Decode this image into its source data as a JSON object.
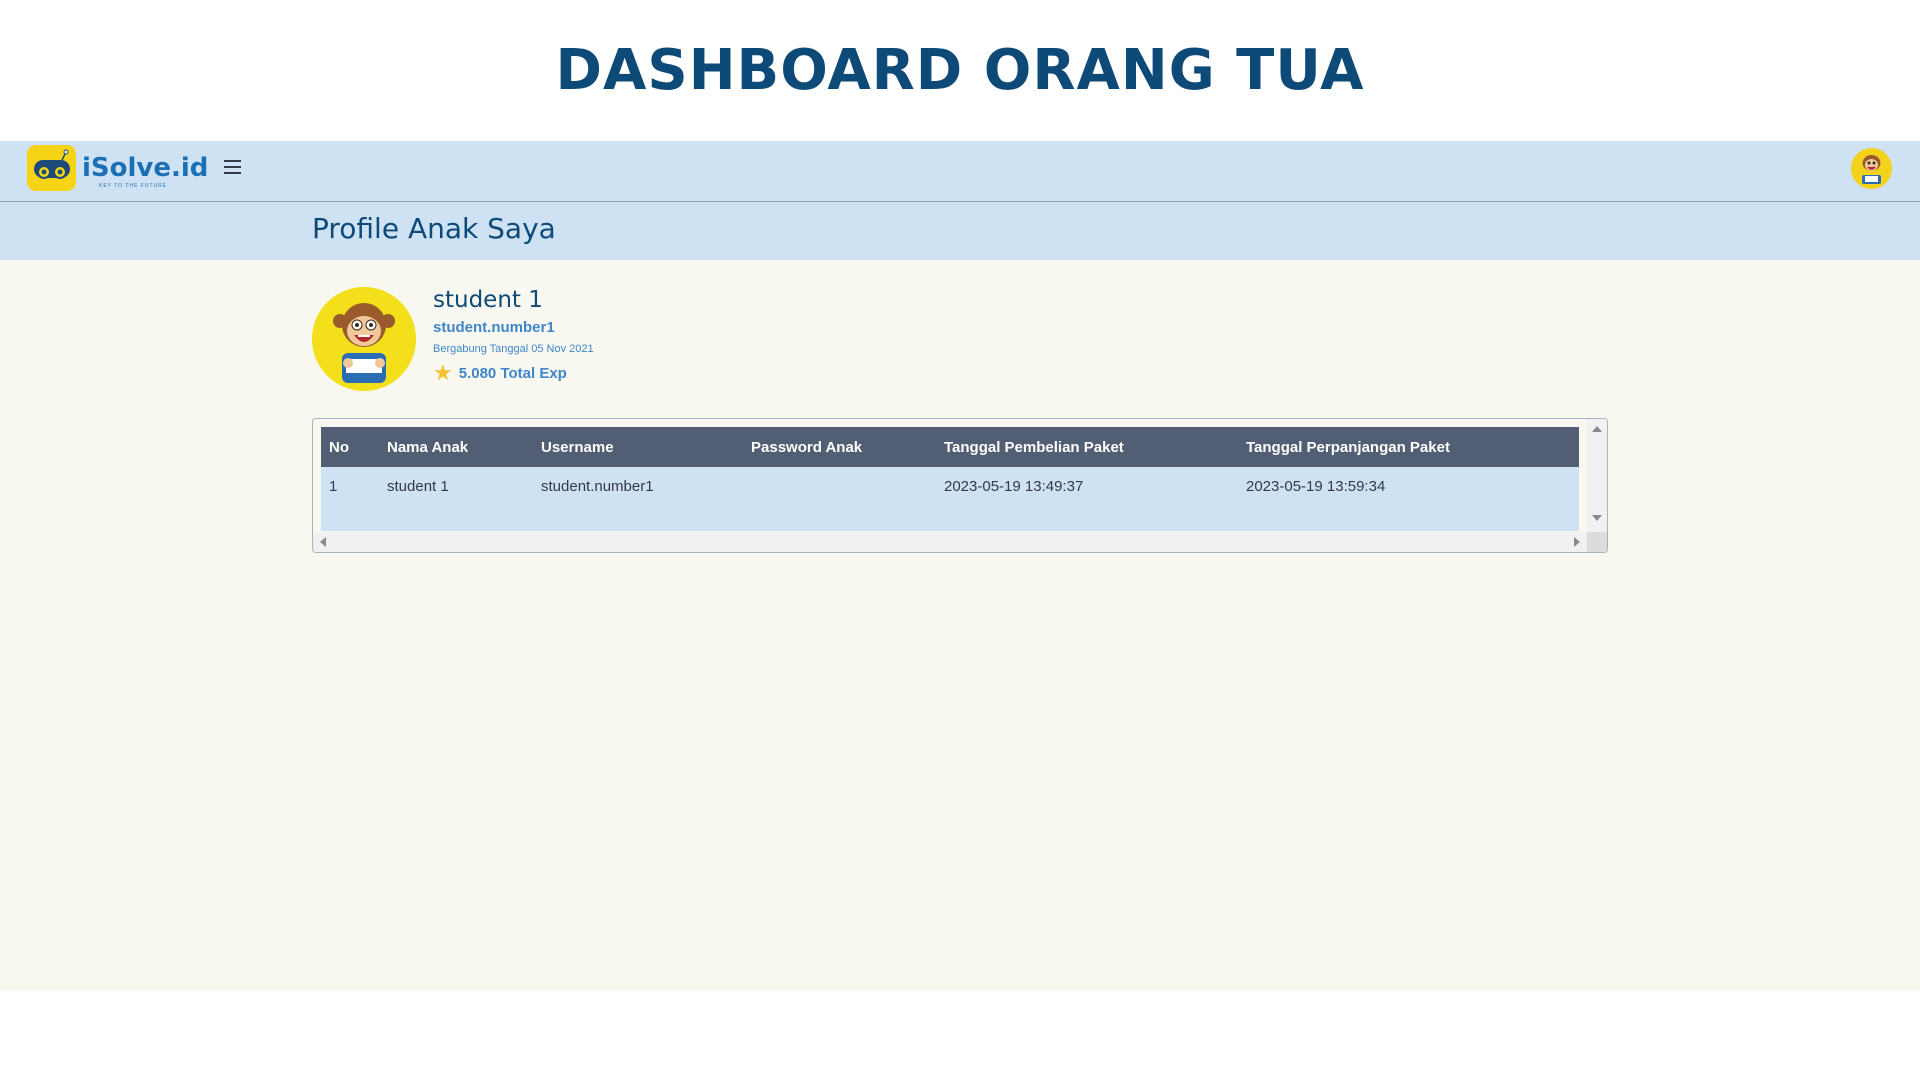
{
  "slide": {
    "title": "DASHBOARD ORANG TUA"
  },
  "navbar": {
    "logo_text": "iSolve.id",
    "logo_tagline": "KEY TO THE FUTURE",
    "menu_icon": "hamburger-icon",
    "user_avatar_icon": "monkey-avatar-icon"
  },
  "page": {
    "title": "Profile Anak Saya"
  },
  "profile": {
    "name": "student 1",
    "username": "student.number1",
    "joined": "Bergabung Tanggal 05 Nov 2021",
    "exp_icon": "star-icon",
    "exp": "5.080 Total Exp"
  },
  "table": {
    "columns": [
      "No",
      "Nama Anak",
      "Username",
      "Password Anak",
      "Tanggal Pembelian Paket",
      "Tanggal Perpanjangan Paket"
    ],
    "rows": [
      [
        "1",
        "student 1",
        "student.number1",
        "",
        "2023-05-19 13:49:37",
        "2023-05-19 13:59:34"
      ]
    ]
  },
  "colors": {
    "brand_dark": "#0d4a78",
    "brand_light": "#cfe2f3",
    "accent_blue": "#3f86c9",
    "table_header": "#525e74",
    "logo_yellow": "#f5d416",
    "background": "#f9f8f0"
  }
}
